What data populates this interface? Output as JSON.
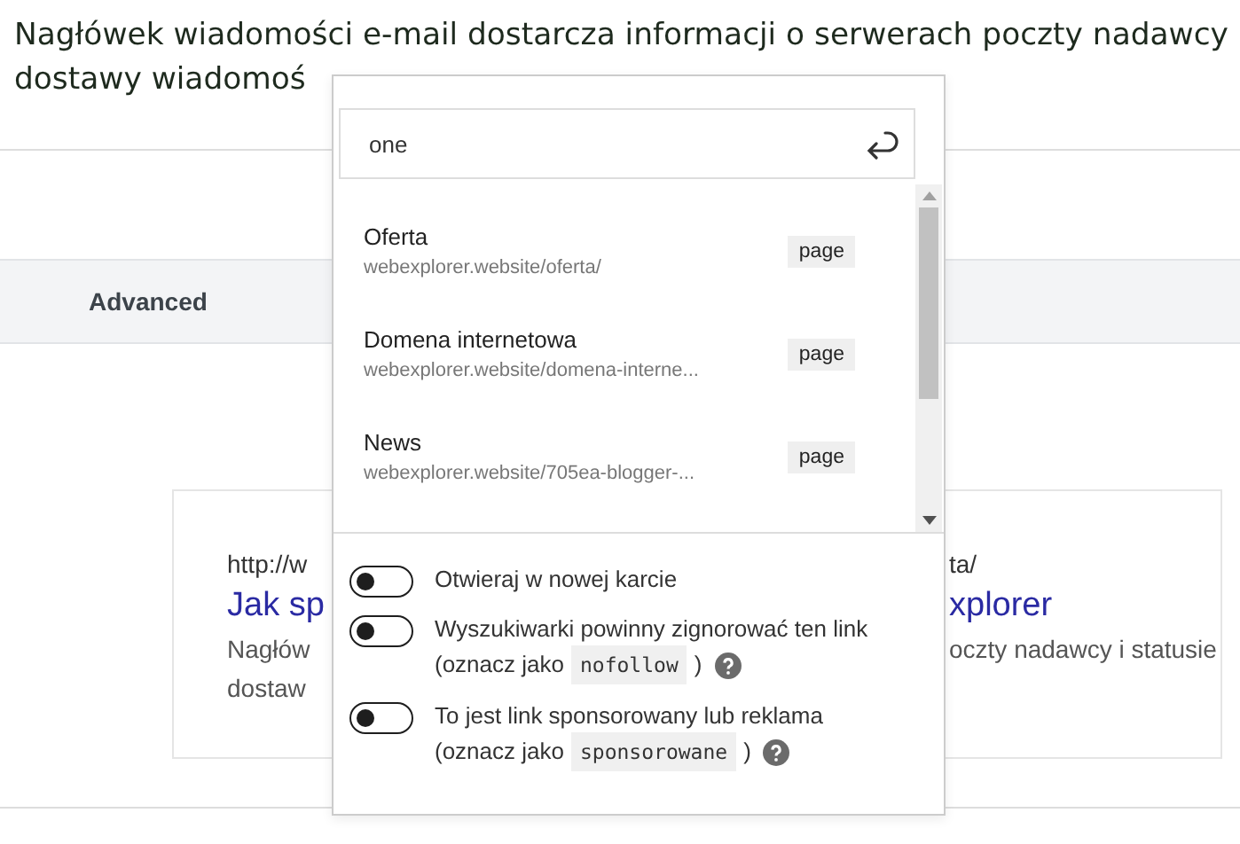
{
  "article": {
    "lines": [
      "Nagłówek wiadomości e-mail dostarcza informacji o serwerach poczty nadawcy",
      "dostawy wiadomoś"
    ]
  },
  "tab_bar": {
    "label": "Advanced"
  },
  "preview": {
    "url_left": "http://w",
    "url_right": "ta/",
    "title_left": "Jak sp",
    "title_right": "xplorer",
    "desc_left": "Nagłów",
    "desc_right": "oczty nadawcy i statusie",
    "desc_line2": "dostaw"
  },
  "link_popup": {
    "search": {
      "value": "one"
    },
    "results": [
      {
        "title": "Oferta",
        "url": "webexplorer.website/oferta/",
        "type": "page"
      },
      {
        "title": "Domena internetowa",
        "url": "webexplorer.website/domena-interne...",
        "type": "page"
      },
      {
        "title": "News",
        "url": "webexplorer.website/705ea-blogger-...",
        "type": "page"
      }
    ],
    "toggles": [
      {
        "label": "Otwieraj w nowej karcie",
        "on": false
      },
      {
        "label": "Wyszukiwarki powinny zignorować ten link",
        "on": false,
        "hint_before": "(oznacz jako",
        "code": "nofollow",
        "hint_after": ")"
      },
      {
        "label": "To jest link sponsorowany lub reklama",
        "on": false,
        "hint_before": "(oznacz jako",
        "code": "sponsorowane",
        "hint_after": ")"
      }
    ]
  }
}
